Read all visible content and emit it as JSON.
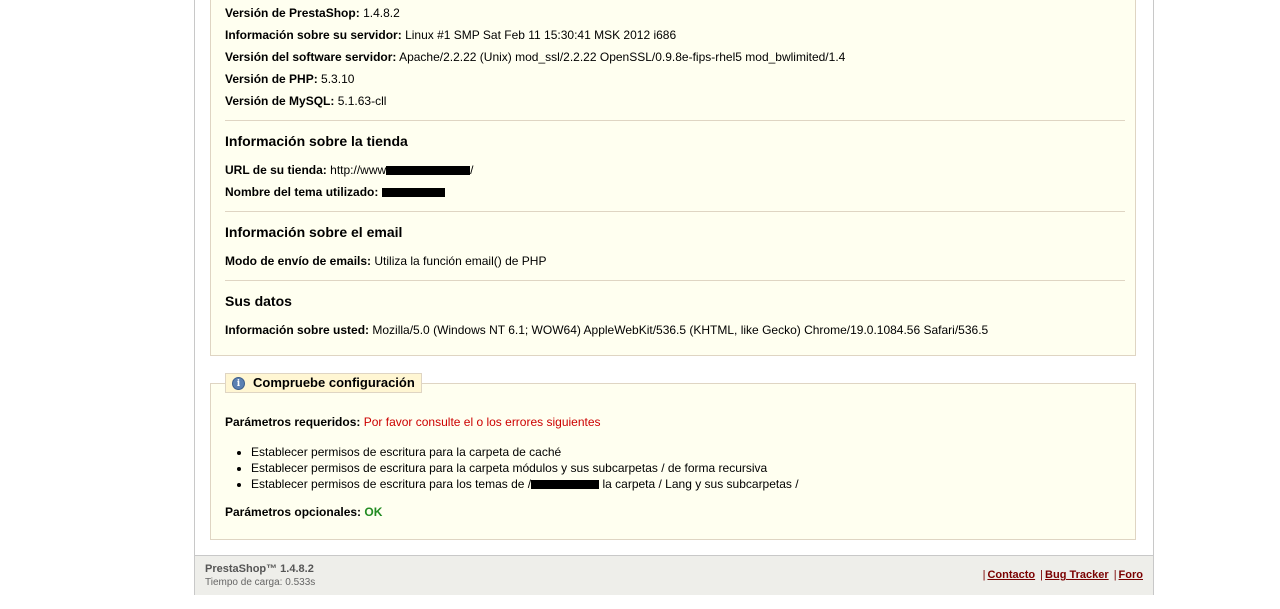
{
  "server_info": {
    "rows": [
      {
        "label": "Versión de PrestaShop:",
        "value": "1.4.8.2"
      },
      {
        "label": "Información sobre su servidor:",
        "value": "Linux #1 SMP Sat Feb 11 15:30:41 MSK 2012 i686"
      },
      {
        "label": "Versión del software servidor:",
        "value": "Apache/2.2.22 (Unix) mod_ssl/2.2.22 OpenSSL/0.9.8e-fips-rhel5 mod_bwlimited/1.4"
      },
      {
        "label": "Versión de PHP:",
        "value": "5.3.10"
      },
      {
        "label": "Versión de MySQL:",
        "value": "5.1.63-cll"
      }
    ]
  },
  "store_info": {
    "title": "Información sobre la tienda",
    "url_label": "URL de su tienda:",
    "url_value": "http://www",
    "url_suffix": "/",
    "theme_label": "Nombre del tema utilizado:"
  },
  "email_info": {
    "title": "Información sobre el email",
    "mode_label": "Modo de envío de emails:",
    "mode_value": "Utiliza la función email() de PHP"
  },
  "your_data": {
    "title": "Sus datos",
    "about_label": "Información sobre usted:",
    "about_value": "Mozilla/5.0 (Windows NT 6.1; WOW64) AppleWebKit/536.5 (KHTML, like Gecko) Chrome/19.0.1084.56 Safari/536.5"
  },
  "config_check": {
    "title": "Compruebe configuración",
    "required_label": "Parámetros requeridos:",
    "required_value": "Por favor consulte el o los errores siguientes",
    "errors": [
      "Establecer permisos de escritura para la carpeta de caché",
      "Establecer permisos de escritura para la carpeta módulos y sus subcarpetas / de forma recursiva"
    ],
    "error3_prefix": "Establecer permisos de escritura para los temas de /",
    "error3_suffix": "la carpeta / Lang y sus subcarpetas /",
    "optional_label": "Parámetros opcionales:",
    "optional_value": "OK",
    "error_color": "#cc0000",
    "ok_color": "#228b22"
  },
  "footer": {
    "version": "PrestaShop™ 1.4.8.2",
    "load_time": "Tiempo de carga: 0.533s",
    "links": [
      "Contacto",
      "Bug Tracker",
      "Foro"
    ]
  }
}
